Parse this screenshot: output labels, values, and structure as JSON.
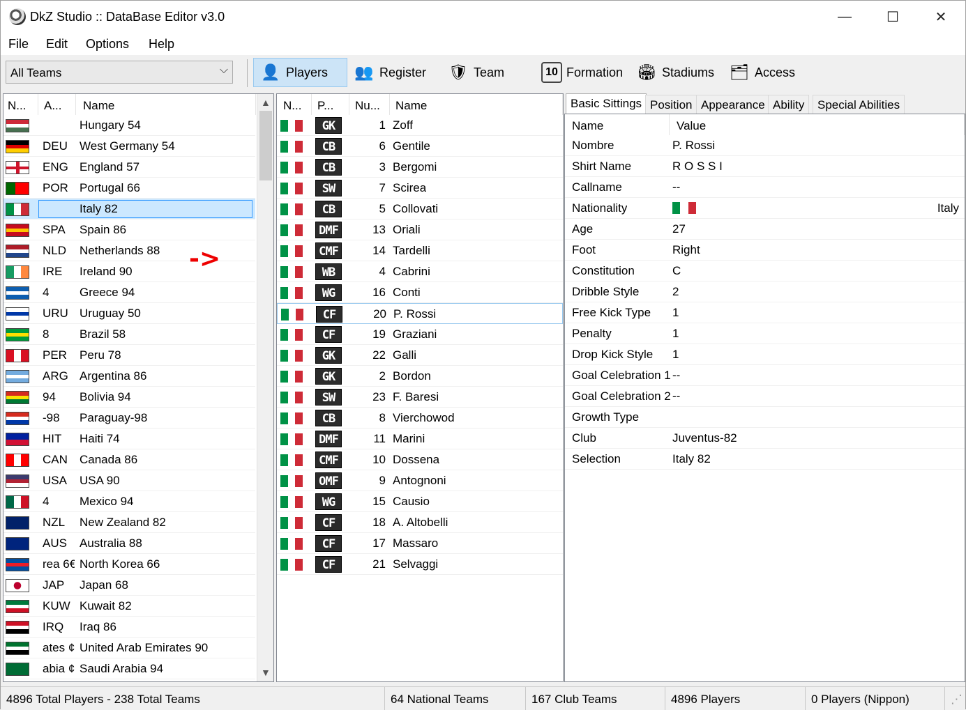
{
  "window": {
    "title": "DkZ Studio :: DataBase Editor v3.0",
    "minimize": "—",
    "maximize": "☐",
    "close": "✕"
  },
  "menu": [
    "File",
    "Edit",
    "Options",
    "Help"
  ],
  "toolbar": {
    "team_filter": "All Teams",
    "buttons": [
      {
        "label": "Players",
        "icon": "player-icon",
        "glyph": "👤"
      },
      {
        "label": "Register",
        "icon": "register-icon",
        "glyph": "👥"
      },
      {
        "label": "Team",
        "icon": "team-shield-icon",
        "glyph": "🛡"
      },
      {
        "label": "Formation",
        "icon": "formation-jersey-icon",
        "glyph": "10"
      },
      {
        "label": "Stadiums",
        "icon": "stadium-icon",
        "glyph": "🏟"
      },
      {
        "label": "Access",
        "icon": "access-icon",
        "glyph": "🗂"
      }
    ]
  },
  "teams": {
    "columns": [
      "N...",
      "A...",
      "Name"
    ],
    "selected_index": 4,
    "rows": [
      {
        "abbr": "",
        "name": "Hungary 54",
        "flag": [
          "h",
          "#ce2939",
          "#ffffff",
          "#477050"
        ]
      },
      {
        "abbr": "DEU",
        "name": "West Germany 54",
        "flag": [
          "h",
          "#000000",
          "#dd0000",
          "#ffce00"
        ]
      },
      {
        "abbr": "ENG",
        "name": "England 57",
        "flag": [
          "x",
          "#ffffff",
          "#cf142b"
        ]
      },
      {
        "abbr": "POR",
        "name": "Portugal 66",
        "flag": [
          "v2",
          "#006600",
          "#ff0000"
        ]
      },
      {
        "abbr": "",
        "name": "Italy 82",
        "flag": [
          "v",
          "#009246",
          "#ffffff",
          "#ce2b37"
        ]
      },
      {
        "abbr": "SPA",
        "name": "Spain 86",
        "flag": [
          "h",
          "#c60b1e",
          "#ffc400",
          "#c60b1e"
        ]
      },
      {
        "abbr": "NLD",
        "name": "Netherlands 88",
        "flag": [
          "h",
          "#ae1c28",
          "#ffffff",
          "#21468b"
        ]
      },
      {
        "abbr": "IRE",
        "name": "Ireland 90",
        "flag": [
          "v",
          "#169b62",
          "#ffffff",
          "#ff883e"
        ]
      },
      {
        "abbr": "4",
        "name": "Greece 94",
        "flag": [
          "h",
          "#0d5eaf",
          "#ffffff",
          "#0d5eaf"
        ]
      },
      {
        "abbr": "URU",
        "name": "Uruguay 50",
        "flag": [
          "h",
          "#ffffff",
          "#0038a8",
          "#ffffff"
        ]
      },
      {
        "abbr": "8",
        "name": "Brazil 58",
        "flag": [
          "h",
          "#009c3b",
          "#ffdf00",
          "#009c3b"
        ]
      },
      {
        "abbr": "PER",
        "name": "Peru 78",
        "flag": [
          "v",
          "#d91023",
          "#ffffff",
          "#d91023"
        ]
      },
      {
        "abbr": "ARG",
        "name": "Argentina 86",
        "flag": [
          "h",
          "#74acdf",
          "#ffffff",
          "#74acdf"
        ]
      },
      {
        "abbr": "94",
        "name": "Bolivia 94",
        "flag": [
          "h",
          "#d52b1e",
          "#f9e300",
          "#007934"
        ]
      },
      {
        "abbr": "-98",
        "name": "Paraguay-98",
        "flag": [
          "h",
          "#d52b1e",
          "#ffffff",
          "#0038a8"
        ]
      },
      {
        "abbr": "HIT",
        "name": "Haiti 74",
        "flag": [
          "h",
          "#00209f",
          "#d21034"
        ]
      },
      {
        "abbr": "CAN",
        "name": "Canada 86",
        "flag": [
          "v",
          "#ff0000",
          "#ffffff",
          "#ff0000"
        ]
      },
      {
        "abbr": "USA",
        "name": "USA 90",
        "flag": [
          "h",
          "#3c3b6e",
          "#b22234",
          "#ffffff"
        ]
      },
      {
        "abbr": "4",
        "name": "Mexico 94",
        "flag": [
          "v",
          "#006847",
          "#ffffff",
          "#ce1126"
        ]
      },
      {
        "abbr": "NZL",
        "name": "New Zealand 82",
        "flag": [
          "h",
          "#012169",
          "#012169"
        ]
      },
      {
        "abbr": "AUS",
        "name": "Australia 88",
        "flag": [
          "h",
          "#00247d",
          "#00247d"
        ]
      },
      {
        "abbr": "rea 6€",
        "name": "North Korea 66",
        "flag": [
          "h",
          "#024fa2",
          "#ed1c27",
          "#024fa2"
        ]
      },
      {
        "abbr": "JAP",
        "name": "Japan 68",
        "flag": [
          "jp",
          "#ffffff",
          "#bc002d"
        ]
      },
      {
        "abbr": "KUW",
        "name": "Kuwait 82",
        "flag": [
          "h",
          "#007a3d",
          "#ffffff",
          "#ce1126"
        ]
      },
      {
        "abbr": "IRQ",
        "name": "Iraq 86",
        "flag": [
          "h",
          "#ce1126",
          "#ffffff",
          "#000000"
        ]
      },
      {
        "abbr": "ates ¢",
        "name": "United Arab Emirates 90",
        "flag": [
          "h",
          "#00732f",
          "#ffffff",
          "#000000"
        ]
      },
      {
        "abbr": "abia ¢",
        "name": "Saudi Arabia 94",
        "flag": [
          "h",
          "#006c35",
          "#006c35"
        ]
      }
    ],
    "annotation": "->"
  },
  "players": {
    "columns": [
      "N...",
      "P...",
      "Nu...",
      "Name"
    ],
    "highlighted_index": 9,
    "rows": [
      {
        "pos": "GK",
        "num": "1",
        "name": "Zoff"
      },
      {
        "pos": "CB",
        "num": "6",
        "name": "Gentile"
      },
      {
        "pos": "CB",
        "num": "3",
        "name": "Bergomi"
      },
      {
        "pos": "SW",
        "num": "7",
        "name": "Scirea"
      },
      {
        "pos": "CB",
        "num": "5",
        "name": "Collovati"
      },
      {
        "pos": "DMF",
        "num": "13",
        "name": "Oriali"
      },
      {
        "pos": "CMF",
        "num": "14",
        "name": "Tardelli"
      },
      {
        "pos": "WB",
        "num": "4",
        "name": "Cabrini"
      },
      {
        "pos": "WG",
        "num": "16",
        "name": "Conti"
      },
      {
        "pos": "CF",
        "num": "20",
        "name": "P. Rossi"
      },
      {
        "pos": "CF",
        "num": "19",
        "name": "Graziani"
      },
      {
        "pos": "GK",
        "num": "22",
        "name": "Galli"
      },
      {
        "pos": "GK",
        "num": "2",
        "name": "Bordon"
      },
      {
        "pos": "SW",
        "num": "23",
        "name": "F. Baresi"
      },
      {
        "pos": "CB",
        "num": "8",
        "name": "Vierchowod"
      },
      {
        "pos": "DMF",
        "num": "11",
        "name": "Marini"
      },
      {
        "pos": "CMF",
        "num": "10",
        "name": "Dossena"
      },
      {
        "pos": "OMF",
        "num": "9",
        "name": "Antognoni"
      },
      {
        "pos": "WG",
        "num": "15",
        "name": "Causio"
      },
      {
        "pos": "CF",
        "num": "18",
        "name": "A. Altobelli"
      },
      {
        "pos": "CF",
        "num": "17",
        "name": "Massaro"
      },
      {
        "pos": "CF",
        "num": "21",
        "name": "Selvaggi"
      }
    ]
  },
  "detail": {
    "tabs": [
      "Basic Sittings",
      "Position",
      "Appearance",
      "Ability",
      "Special Abilities"
    ],
    "active_tab": 0,
    "header": {
      "key": "Name",
      "value": "Value"
    },
    "rows": [
      {
        "key": "Nombre",
        "value": "P. Rossi"
      },
      {
        "key": "Shirt Name",
        "value": "R O S S I"
      },
      {
        "key": "Callname",
        "value": "--"
      },
      {
        "key": "Nationality",
        "value": "Italy",
        "flag": true
      },
      {
        "key": "Age",
        "value": "27"
      },
      {
        "key": "Foot",
        "value": "Right"
      },
      {
        "key": "Constitution",
        "value": "C"
      },
      {
        "key": "Dribble Style",
        "value": "2"
      },
      {
        "key": "Free Kick Type",
        "value": "1"
      },
      {
        "key": "Penalty",
        "value": "1"
      },
      {
        "key": "Drop Kick Style",
        "value": "1"
      },
      {
        "key": "Goal Celebration 1",
        "value": "--"
      },
      {
        "key": "Goal Celebration 2",
        "value": "--"
      },
      {
        "key": "Growth Type",
        "value": ""
      },
      {
        "key": "Club",
        "value": "Juventus-82"
      },
      {
        "key": "Selection",
        "value": "Italy 82"
      }
    ]
  },
  "status": {
    "totals": "4896 Total Players  -  238 Total Teams",
    "national": "64 National Teams",
    "club": "167 Club Teams",
    "players": "4896 Players",
    "nippon": "0 Players (Nippon)"
  },
  "colors": {
    "italy_green": "#009246",
    "italy_white": "#ffffff",
    "italy_red": "#ce2b37",
    "selection": "#cce8ff",
    "annotation_red": "#ee0000"
  }
}
